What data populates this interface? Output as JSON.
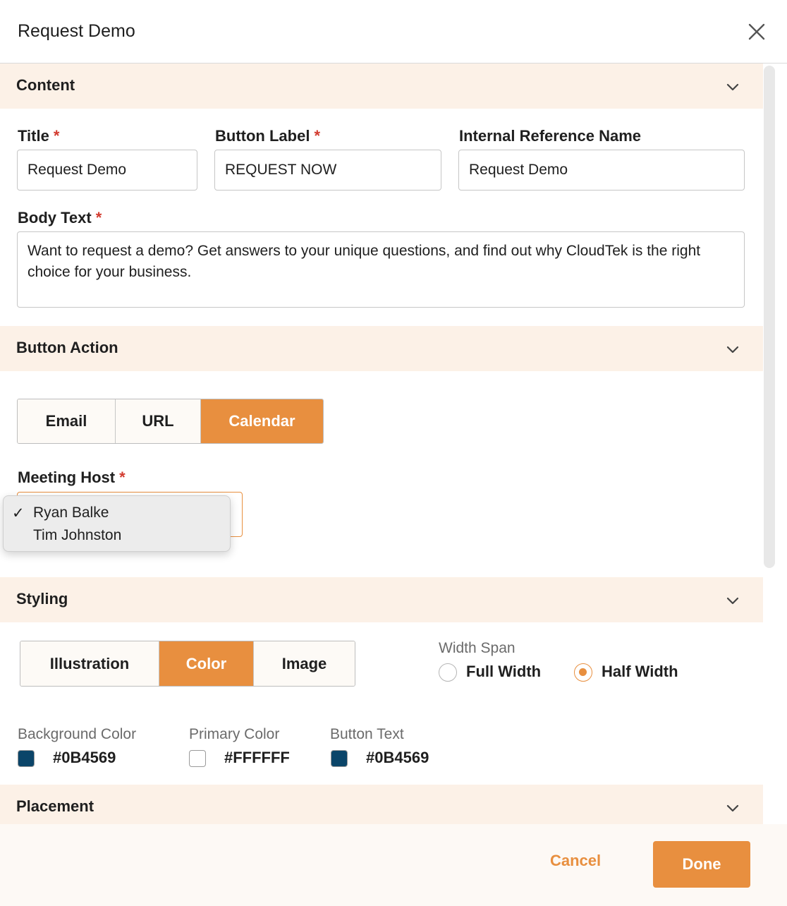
{
  "window": {
    "title": "Request Demo",
    "close_icon": "close-icon"
  },
  "sections": {
    "content": "Content",
    "button_action": "Button Action",
    "styling": "Styling",
    "placement": "Placement"
  },
  "content": {
    "title_label": "Title",
    "title_value": "Request Demo",
    "button_label_label": "Button Label",
    "button_label_value": "REQUEST NOW",
    "internal_ref_label": "Internal Reference Name",
    "internal_ref_value": "Request Demo",
    "body_text_label": "Body Text",
    "body_text_value": "Want to request a demo? Get answers to your unique questions, and find out why CloudTek is the right choice for your business.",
    "required_mark": "*"
  },
  "button_action": {
    "options": [
      "Email",
      "URL",
      "Calendar"
    ],
    "selected": "Calendar",
    "meeting_host_label": "Meeting Host",
    "meeting_host_options": [
      "Ryan Balke",
      "Tim Johnston"
    ],
    "meeting_host_selected": "Ryan Balke",
    "check_mark": "✓"
  },
  "styling": {
    "media_options": [
      "Illustration",
      "Color",
      "Image"
    ],
    "media_selected": "Color",
    "width_span_label": "Width Span",
    "width_options": [
      "Full Width",
      "Half Width"
    ],
    "width_selected": "Half Width",
    "background_color_label": "Background Color",
    "background_color": "#0B4569",
    "primary_color_label": "Primary Color",
    "primary_color": "#FFFFFF",
    "button_text_label": "Button Text",
    "button_text_color": "#0B4569"
  },
  "footer": {
    "cancel_label": "Cancel",
    "done_label": "Done"
  },
  "colors": {
    "accent": "#e88f3f",
    "section_bg": "#fcf1e7",
    "required": "#d23b2f"
  }
}
